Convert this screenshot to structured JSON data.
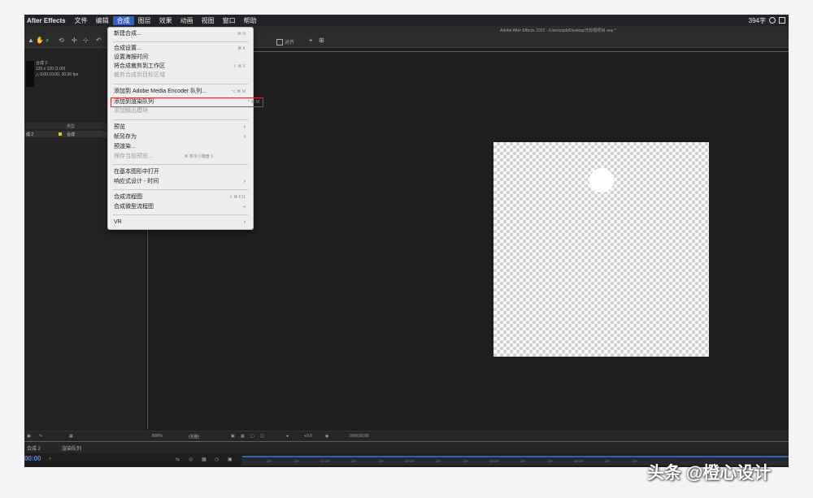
{
  "menubar": {
    "app": "After Effects",
    "items": [
      "文件",
      "编辑",
      "合成",
      "图层",
      "效果",
      "动画",
      "视图",
      "窗口",
      "帮助"
    ],
    "active_index": 2,
    "status": "394字"
  },
  "titlebar": "Adobe After Effects 2022 - /Users/zpb/Desktop/无标题项目.aep *",
  "toolbar": {
    "align_label": "对齐"
  },
  "project": {
    "comp_name": "合成 2",
    "comp_size": "120 x 120 (1.00)",
    "comp_duration": "△ 0;00;10;00, 30.00 fps",
    "header_type": "类型",
    "row_name": "成 2",
    "row_type": "合成"
  },
  "menu": {
    "items": [
      {
        "label": "新建合成...",
        "shortcut": "⌘ N",
        "disabled": false
      },
      {
        "label": "合成设置...",
        "shortcut": "⌘ K",
        "disabled": false
      },
      {
        "label": "设置海报时间",
        "shortcut": "",
        "disabled": false
      },
      {
        "label": "将合成裁剪到工作区",
        "shortcut": "⇧ ⌘ X",
        "disabled": false
      },
      {
        "label": "裁剪合成到目标区域",
        "shortcut": "",
        "disabled": true
      },
      {
        "label": "添加到 Adobe Media Encoder 队列...",
        "shortcut": "⌥ ⌘ M",
        "disabled": false
      },
      {
        "label": "添加到渲染队列",
        "shortcut": "^ ⌘ M",
        "disabled": false
      },
      {
        "label": "添加输出模块",
        "shortcut": "",
        "disabled": true
      },
      {
        "label": "预览",
        "shortcut": "",
        "disabled": false
      },
      {
        "label": "帧另存为",
        "shortcut": "",
        "disabled": false
      },
      {
        "label": "预渲染...",
        "shortcut": "",
        "disabled": false
      },
      {
        "label": "保存当前预览...",
        "shortcut": "⌘ 数字小键盘 0",
        "disabled": true
      },
      {
        "label": "在基本图形中打开",
        "shortcut": "",
        "disabled": false
      },
      {
        "label": "响应式设计 - 时间",
        "shortcut": "",
        "disabled": false
      },
      {
        "label": "合成流程图",
        "shortcut": "⇧ ⌘ F11",
        "disabled": false
      },
      {
        "label": "合成微型流程图",
        "shortcut": "⇥",
        "disabled": false
      },
      {
        "label": "VR",
        "shortcut": "",
        "disabled": false
      }
    ]
  },
  "viewer_bar": {
    "zoom": "800%",
    "quality": "(完整)",
    "exposure": "+0.0",
    "timecode": "0;00;00;00"
  },
  "timeline": {
    "tab_comp": "合成 2",
    "tab_render": "渲染队列",
    "timecode": "00:00",
    "ticks": [
      "10f",
      "20f",
      "01:00f",
      "10f",
      "20f",
      "02:00f",
      "10f",
      "20f",
      "03:00f",
      "10f",
      "20f",
      "04:00f",
      "10f",
      "20f"
    ]
  },
  "watermark": "头条 @橙心设计",
  "colors": {
    "highlight_box": "#e02a2a",
    "accent": "#2f5fc9"
  }
}
